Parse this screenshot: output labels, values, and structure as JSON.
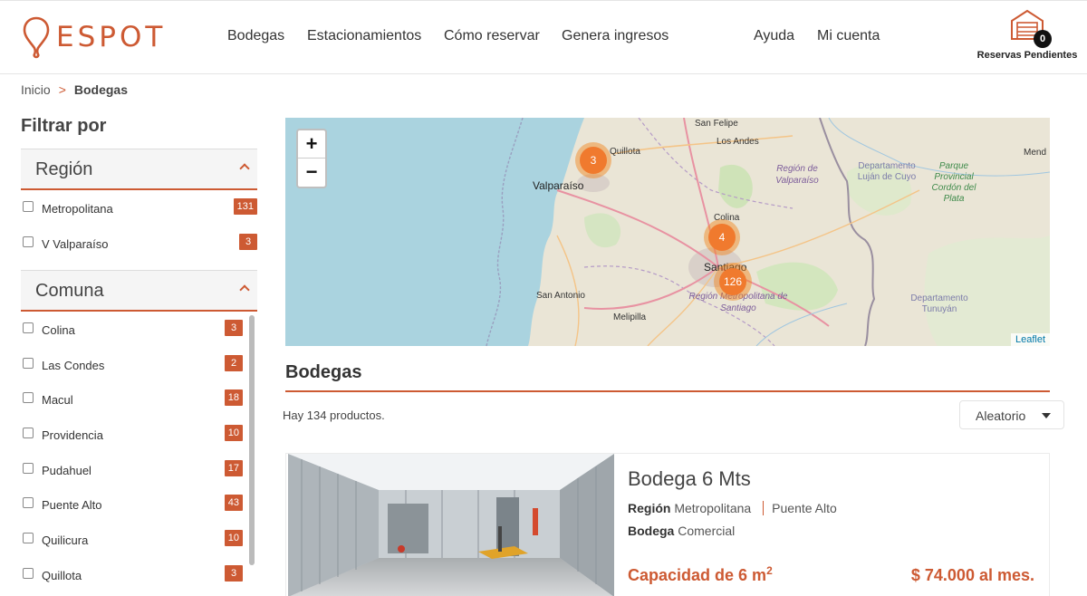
{
  "brand": {
    "name": "ESPOT",
    "color": "#cd5a33"
  },
  "nav": {
    "bodegas": "Bodegas",
    "estacionamientos": "Estacionamientos",
    "como_reservar": "Cómo reservar",
    "genera_ingresos": "Genera ingresos",
    "ayuda": "Ayuda",
    "mi_cuenta": "Mi cuenta"
  },
  "reservas": {
    "count": "0",
    "label": "Reservas Pendientes"
  },
  "breadcrumb": {
    "home": "Inicio",
    "separator": ">",
    "current": "Bodegas"
  },
  "sidebar": {
    "title": "Filtrar por",
    "region": {
      "title": "Región",
      "items": [
        {
          "label": "Metropolitana",
          "count": "131"
        },
        {
          "label": "V Valparaíso",
          "count": "3"
        }
      ]
    },
    "comuna": {
      "title": "Comuna",
      "items": [
        {
          "label": "Colina",
          "count": "3"
        },
        {
          "label": "Las Condes",
          "count": "2"
        },
        {
          "label": "Macul",
          "count": "18"
        },
        {
          "label": "Providencia",
          "count": "10"
        },
        {
          "label": "Pudahuel",
          "count": "17"
        },
        {
          "label": "Puente Alto",
          "count": "43"
        },
        {
          "label": "Quilicura",
          "count": "10"
        },
        {
          "label": "Quillota",
          "count": "3"
        }
      ]
    }
  },
  "map": {
    "zoom_in": "+",
    "zoom_out": "−",
    "attribution": "Leaflet",
    "places": {
      "san_felipe": "San Felipe",
      "los_andes": "Los Andes",
      "quillota": "Quillota",
      "valparaiso": "Valparaíso",
      "region_valparaiso": "Región de Valparaíso",
      "colina": "Colina",
      "santiago": "Santiago",
      "san_antonio": "San Antonio",
      "region_metropolitana": "Región Metropolitana de Santiago",
      "melipilla": "Melipilla",
      "depto_lujan": "Departamento Luján de Cuyo",
      "parque": "Parque Provincial Cordón del Plata",
      "depto_tunuyan": "Departamento Tunuyán",
      "mend": "Mend"
    },
    "clusters": [
      "3",
      "4",
      "126"
    ]
  },
  "results": {
    "title": "Bodegas",
    "count_text": "Hay 134 productos.",
    "sort_value": "Aleatorio"
  },
  "product": {
    "title": "Bodega 6 Mts",
    "region_label": "Región",
    "region_value": "Metropolitana",
    "comuna_value": "Puente Alto",
    "tipo_label": "Bodega",
    "tipo_value": "Comercial",
    "capacity": "Capacidad de 6 m",
    "capacity_exp": "2",
    "price": "$ 74.000 al mes."
  }
}
